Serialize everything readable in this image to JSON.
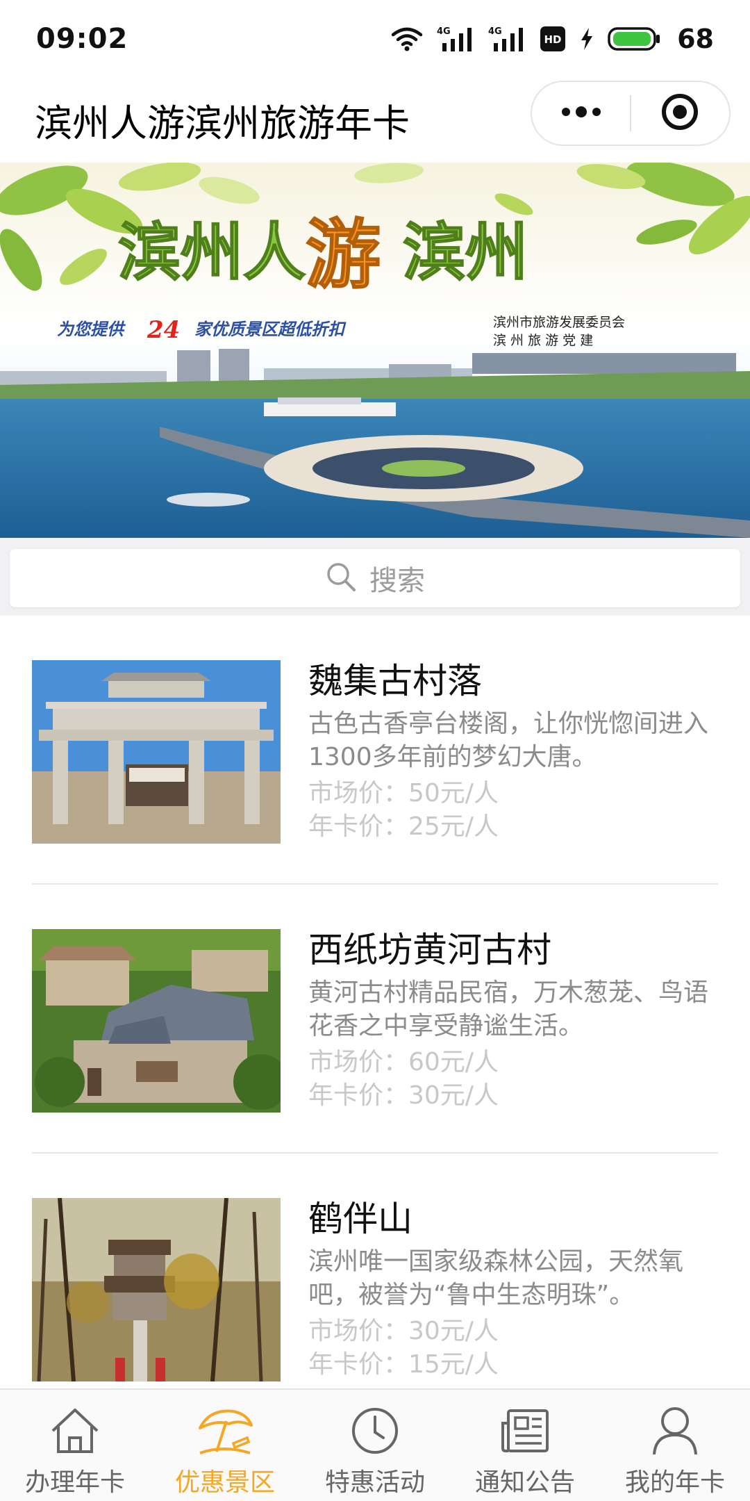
{
  "status_bar": {
    "time": "09:02",
    "signal_1": "4G",
    "signal_2": "4G",
    "hd_badge": "HD",
    "battery": "68"
  },
  "nav": {
    "title": "滨州人游滨州旅游年卡"
  },
  "banner": {
    "headline_part1": "滨州人",
    "headline_highlight": "游",
    "headline_part2": "滨州",
    "tagline_prefix": "为您提供",
    "tagline_number": "24",
    "tagline_suffix": "家优质景区超低折扣",
    "org_line1": "滨州市旅游发展委员会",
    "org_line2": "滨 州 旅 游 党 建"
  },
  "search": {
    "placeholder": "搜索"
  },
  "attractions": [
    {
      "name": "魏集古村落",
      "desc": "古色古香亭台楼阁，让你恍惚间进入1300多年前的梦幻大唐。",
      "market_price": "市场价：50元/人",
      "card_price": "年卡价：25元/人"
    },
    {
      "name": "西纸坊黄河古村",
      "desc": "黄河古村精品民宿，万木葱茏、鸟语花香之中享受静谧生活。",
      "market_price": "市场价：60元/人",
      "card_price": "年卡价：30元/人"
    },
    {
      "name": "鹤伴山",
      "desc": "滨州唯一国家级森林公园，天然氧吧，被誉为“鲁中生态明珠”。",
      "market_price": "市场价：30元/人",
      "card_price": "年卡价：15元/人"
    }
  ],
  "tabs": [
    {
      "label": "办理年卡",
      "icon": "home-icon",
      "active": false
    },
    {
      "label": "优惠景区",
      "icon": "beach-umbrella-icon",
      "active": true
    },
    {
      "label": "特惠活动",
      "icon": "clock-icon",
      "active": false
    },
    {
      "label": "通知公告",
      "icon": "newspaper-icon",
      "active": false
    },
    {
      "label": "我的年卡",
      "icon": "user-icon",
      "active": false
    }
  ],
  "colors": {
    "accent": "#f5a623",
    "inactive": "#666666",
    "banner_title_green": "#8cc63f",
    "banner_title_orange": "#f7931e"
  }
}
